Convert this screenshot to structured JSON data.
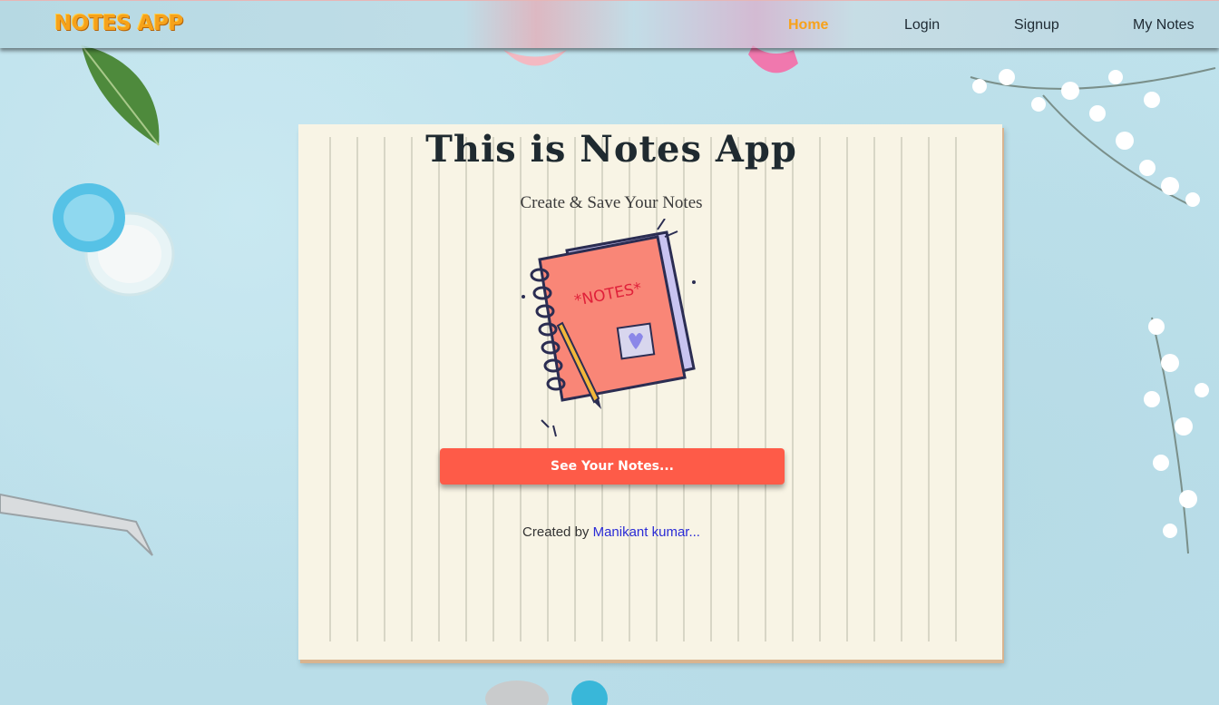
{
  "navbar": {
    "brand": "NOTES APP",
    "links": [
      {
        "label": "Home",
        "active": true
      },
      {
        "label": "Login",
        "active": false
      },
      {
        "label": "Signup",
        "active": false
      },
      {
        "label": "My Notes",
        "active": false
      }
    ]
  },
  "main": {
    "title": "This is Notes App",
    "subtitle": "Create & Save Your Notes",
    "illustration": {
      "icon": "notebook-icon",
      "label": "*NOTES*"
    },
    "cta_label": "See Your Notes...",
    "credit_prefix": "Created by",
    "credit_author": "Manikant kumar..."
  },
  "colors": {
    "brand": "#f6a21a",
    "nav_active": "#f7a21b",
    "button": "#fe5b48",
    "author_link": "#2a2bd6",
    "card": "#f8f4e5",
    "background": "#bfe0ea"
  }
}
